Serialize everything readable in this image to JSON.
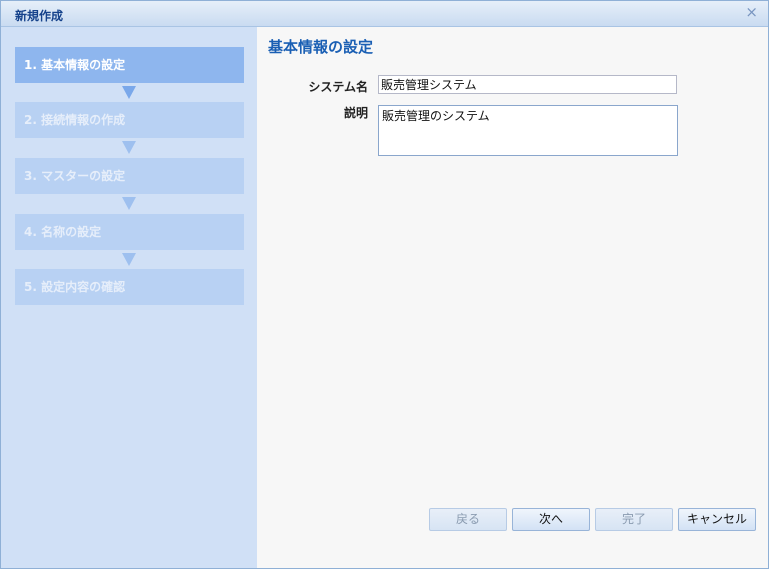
{
  "dialog": {
    "title": "新規作成",
    "close_symbol": "×"
  },
  "sidebar": {
    "steps": [
      {
        "label": "1. 基本情報の設定",
        "active": true
      },
      {
        "label": "2. 接続情報の作成",
        "active": false
      },
      {
        "label": "3. マスターの設定",
        "active": false
      },
      {
        "label": "4. 名称の設定",
        "active": false
      },
      {
        "label": "5. 設定内容の確認",
        "active": false
      }
    ]
  },
  "main": {
    "heading": "基本情報の設定",
    "system_name_label": "システム名",
    "system_name_value": "販売管理システム",
    "description_label": "説明",
    "description_value": "販売管理のシステム"
  },
  "buttons": {
    "back": "戻る",
    "next": "次へ",
    "finish": "完了",
    "cancel": "キャンセル"
  },
  "colors": {
    "accent": "#1a5fb4",
    "active_step": "#8eb6ee",
    "inactive_step": "#b8d1f3"
  }
}
